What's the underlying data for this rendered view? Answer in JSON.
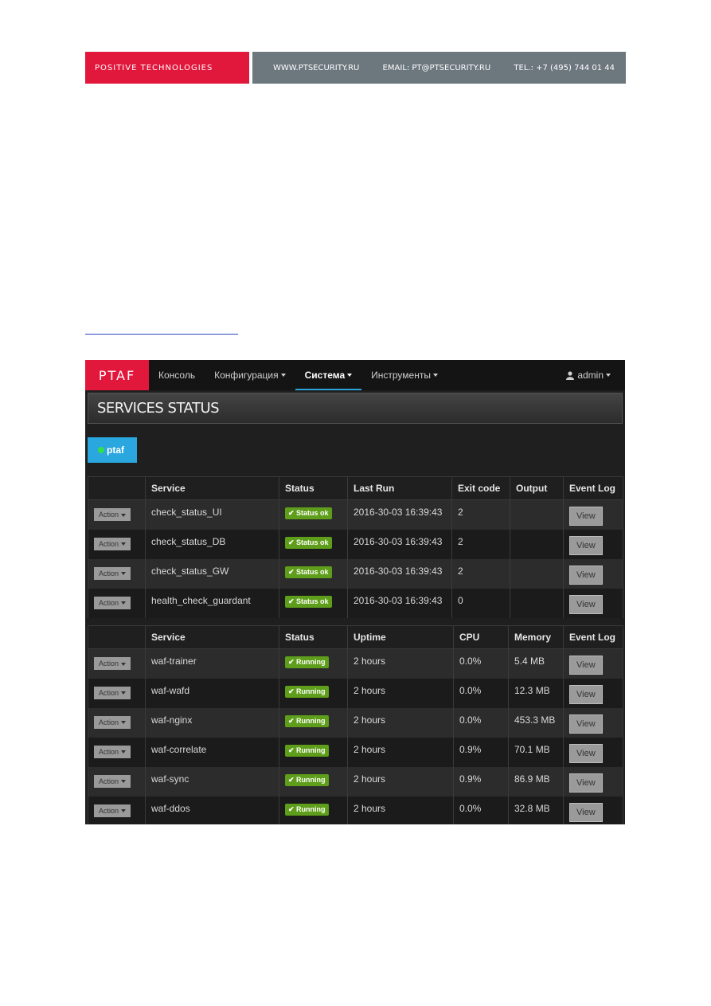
{
  "letterhead": {
    "company": "POSITIVE TECHNOLOGIES",
    "website": "WWW.PTSECURITY.RU",
    "email": "EMAIL: PT@PTSECURITY.RU",
    "phone": "TEL.: +7 (495) 744 01 44",
    "colors": {
      "red": "#e2173c",
      "grey": "#6d777e"
    }
  },
  "app": {
    "brand": "PTAF",
    "nav": [
      "Консоль",
      "Конфигурация",
      "Система",
      "Инструменты"
    ],
    "active_nav": "Система",
    "user": "admin",
    "page_title": "SERVICES STATUS",
    "tab": "ptaf"
  },
  "checks": {
    "headers": [
      "",
      "Service",
      "Status",
      "Last Run",
      "Exit code",
      "Output",
      "Event Log"
    ],
    "action_label": "Action",
    "view_label": "View",
    "rows": [
      {
        "service": "check_status_UI",
        "status": "Status ok",
        "last_run": "2016-30-03 16:39:43",
        "exit_code": "2",
        "output": ""
      },
      {
        "service": "check_status_DB",
        "status": "Status ok",
        "last_run": "2016-30-03 16:39:43",
        "exit_code": "2",
        "output": ""
      },
      {
        "service": "check_status_GW",
        "status": "Status ok",
        "last_run": "2016-30-03 16:39:43",
        "exit_code": "2",
        "output": ""
      },
      {
        "service": "health_check_guardant",
        "status": "Status ok",
        "last_run": "2016-30-03 16:39:43",
        "exit_code": "0",
        "output": ""
      }
    ]
  },
  "services": {
    "headers": [
      "",
      "Service",
      "Status",
      "Uptime",
      "CPU",
      "Memory",
      "Event Log"
    ],
    "action_label": "Action",
    "view_label": "View",
    "rows": [
      {
        "service": "waf-trainer",
        "status": "Running",
        "uptime": "2 hours",
        "cpu": "0.0%",
        "memory": "5.4 MB"
      },
      {
        "service": "waf-wafd",
        "status": "Running",
        "uptime": "2 hours",
        "cpu": "0.0%",
        "memory": "12.3 MB"
      },
      {
        "service": "waf-nginx",
        "status": "Running",
        "uptime": "2 hours",
        "cpu": "0.0%",
        "memory": "453.3 MB"
      },
      {
        "service": "waf-correlate",
        "status": "Running",
        "uptime": "2 hours",
        "cpu": "0.9%",
        "memory": "70.1 MB"
      },
      {
        "service": "waf-sync",
        "status": "Running",
        "uptime": "2 hours",
        "cpu": "0.9%",
        "memory": "86.9 MB"
      },
      {
        "service": "waf-ddos",
        "status": "Running",
        "uptime": "2 hours",
        "cpu": "0.0%",
        "memory": "32.8 MB"
      }
    ]
  },
  "status_badge_color": "#5e9e1a",
  "tab_color": "#29a7de"
}
